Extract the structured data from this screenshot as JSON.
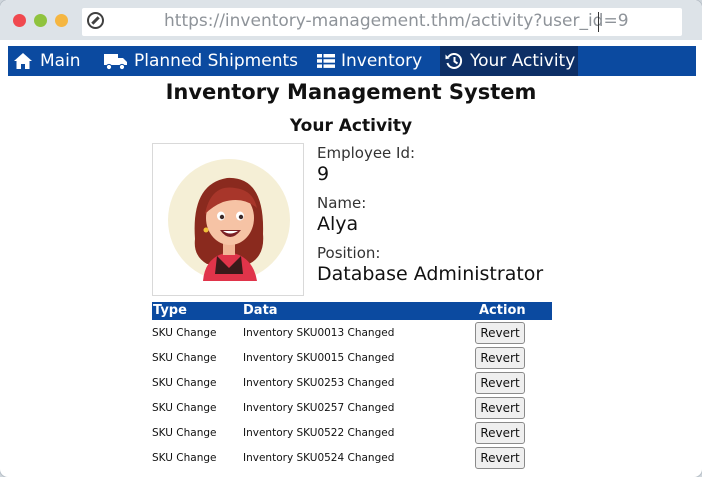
{
  "browser": {
    "url": "https://inventory-management.thm/activity?user_id=9"
  },
  "nav": {
    "items": [
      {
        "label": "Main",
        "icon": "home-icon"
      },
      {
        "label": "Planned Shipments",
        "icon": "truck-icon"
      },
      {
        "label": "Inventory",
        "icon": "table-list-icon"
      },
      {
        "label": "Your Activity",
        "icon": "history-icon",
        "active": true
      }
    ]
  },
  "page": {
    "title": "Inventory Management System",
    "subtitle": "Your Activity"
  },
  "profile": {
    "employee_id_label": "Employee Id:",
    "employee_id": "9",
    "name_label": "Name:",
    "name": "Alya",
    "position_label": "Position:",
    "position": "Database Administrator"
  },
  "activity": {
    "headers": {
      "type": "Type",
      "data": "Data",
      "action": "Action"
    },
    "rows": [
      {
        "type": "SKU Change",
        "data": "Inventory SKU0013 Changed",
        "action": "Revert"
      },
      {
        "type": "SKU Change",
        "data": "Inventory SKU0015 Changed",
        "action": "Revert"
      },
      {
        "type": "SKU Change",
        "data": "Inventory SKU0253 Changed",
        "action": "Revert"
      },
      {
        "type": "SKU Change",
        "data": "Inventory SKU0257 Changed",
        "action": "Revert"
      },
      {
        "type": "SKU Change",
        "data": "Inventory SKU0522 Changed",
        "action": "Revert"
      },
      {
        "type": "SKU Change",
        "data": "Inventory SKU0524 Changed",
        "action": "Revert"
      }
    ]
  },
  "colors": {
    "nav_bg": "#0b4aa0",
    "nav_active": "#0d2f66",
    "avatar_bg": "#f5efd6"
  }
}
